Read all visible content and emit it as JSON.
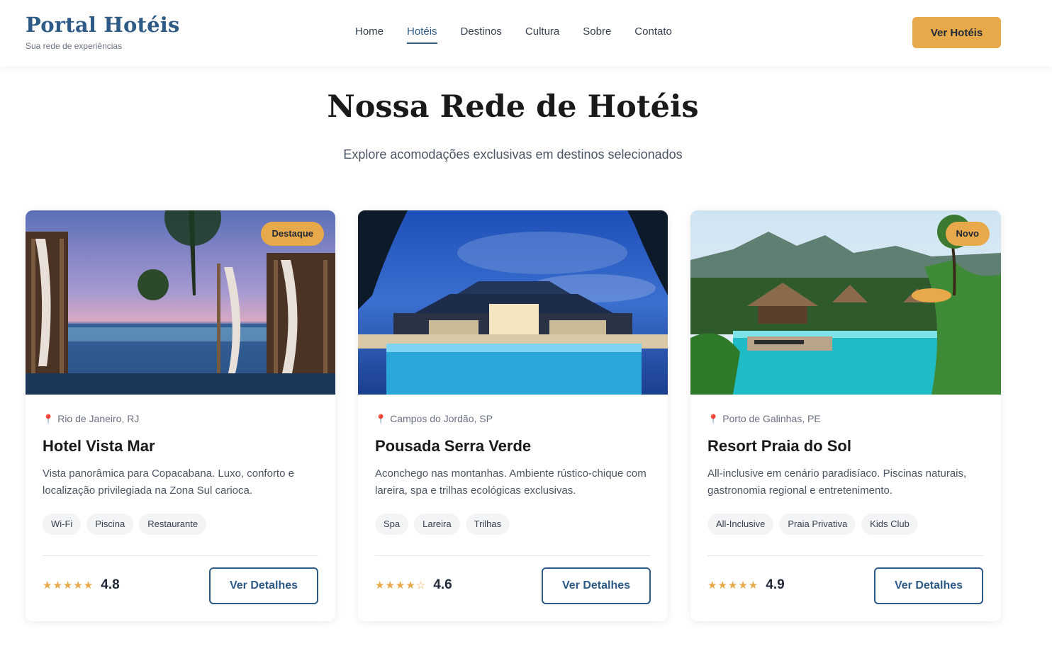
{
  "header": {
    "brand_title": "Portal Hotéis",
    "brand_subtitle": "Sua rede de experiências",
    "nav": [
      "Home",
      "Hotéis",
      "Destinos",
      "Cultura",
      "Sobre",
      "Contato"
    ],
    "active_nav": "Hotéis",
    "cta_label": "Ver Hotéis"
  },
  "hero": {
    "title": "Nossa Rede de Hotéis",
    "subtitle": "Explore acomodações exclusivas em destinos selecionados"
  },
  "cards": [
    {
      "badge": "Destaque",
      "location": "Rio de Janeiro, RJ",
      "name": "Hotel Vista Mar",
      "description": "Vista panorâmica para Copacabana. Luxo, conforto e localização privilegiada na Zona Sul carioca.",
      "tags": [
        "Wi-Fi",
        "Piscina",
        "Restaurante"
      ],
      "stars": "★★★★★",
      "rating": "4.8",
      "button": "Ver Detalhes"
    },
    {
      "badge": "",
      "location": "Campos do Jordão, SP",
      "name": "Pousada Serra Verde",
      "description": "Aconchego nas montanhas. Ambiente rústico-chique com lareira, spa e trilhas ecológicas exclusivas.",
      "tags": [
        "Spa",
        "Lareira",
        "Trilhas"
      ],
      "stars": "★★★★☆",
      "rating": "4.6",
      "button": "Ver Detalhes"
    },
    {
      "badge": "Novo",
      "location": "Porto de Galinhas, PE",
      "name": "Resort Praia do Sol",
      "description": "All-inclusive em cenário paradisíaco. Piscinas naturais, gastronomia regional e entretenimento.",
      "tags": [
        "All-Inclusive",
        "Praia Privativa",
        "Kids Club"
      ],
      "stars": "★★★★★",
      "rating": "4.9",
      "button": "Ver Detalhes"
    }
  ],
  "colors": {
    "brand": "#2d5a87",
    "accent": "#e8a94a"
  }
}
